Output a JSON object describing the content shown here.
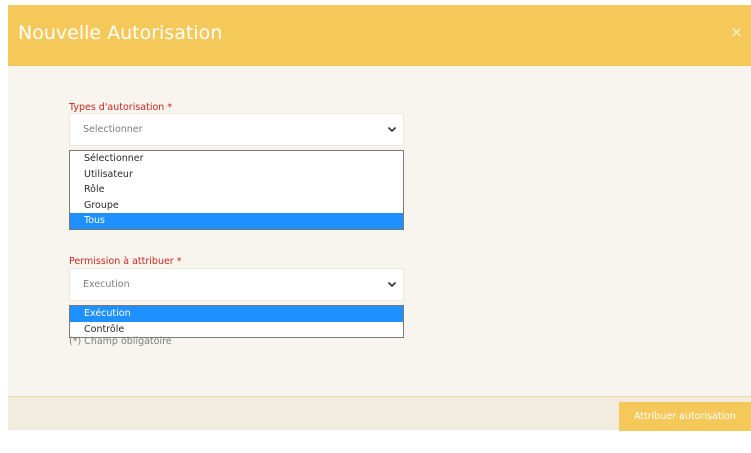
{
  "modal": {
    "title": "Nouvelle Autorisation",
    "close_symbol": "×"
  },
  "authorization_type": {
    "label": "Types d'autorisation *",
    "selected_value": "Selectionner",
    "options": [
      {
        "label": "Sélectionner",
        "highlighted": false
      },
      {
        "label": "Utilisateur",
        "highlighted": false
      },
      {
        "label": "Rôle",
        "highlighted": false
      },
      {
        "label": "Groupe",
        "highlighted": false
      },
      {
        "label": "Tous",
        "highlighted": true
      }
    ]
  },
  "permission": {
    "label": "Permission à attribuer *",
    "selected_value": "Execution",
    "options": [
      {
        "label": "Exécution",
        "highlighted": true
      },
      {
        "label": "Contrôle",
        "highlighted": false
      }
    ]
  },
  "required_note": "(*) Champ obligatoire",
  "footer": {
    "submit_label": "Attribuer autorisation"
  },
  "colors": {
    "header": "#f5c85a",
    "label_red": "#c8261f",
    "highlight": "#1e90ff",
    "body_bg": "#f7f5ee",
    "footer_bg": "#f1ecdd"
  },
  "icons": {
    "close": "close-icon",
    "dropdown": "chevron-down-icon"
  }
}
